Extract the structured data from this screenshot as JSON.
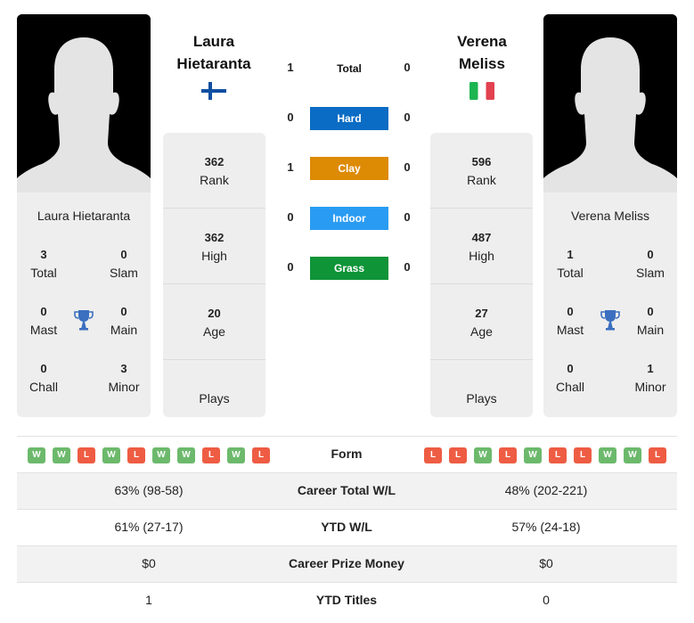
{
  "player_left": {
    "name_line1": "Laura",
    "name_line2": "Hietaranta",
    "full_name": "Laura Hietaranta",
    "flag_icon": "finland-flag-icon",
    "photo_icon": "player-silhouette-icon",
    "titles": {
      "total": {
        "value": "3",
        "label": "Total"
      },
      "slam": {
        "value": "0",
        "label": "Slam"
      },
      "mast": {
        "value": "0",
        "label": "Mast"
      },
      "main": {
        "value": "0",
        "label": "Main"
      },
      "chall": {
        "value": "0",
        "label": "Chall"
      },
      "minor": {
        "value": "3",
        "label": "Minor"
      }
    },
    "stats": {
      "rank": {
        "value": "362",
        "label": "Rank"
      },
      "high": {
        "value": "362",
        "label": "High"
      },
      "age": {
        "value": "20",
        "label": "Age"
      },
      "plays": {
        "value": "",
        "label": "Plays"
      }
    },
    "form": [
      "W",
      "W",
      "L",
      "W",
      "L",
      "W",
      "W",
      "L",
      "W",
      "L"
    ]
  },
  "player_right": {
    "name_line1": "Verena",
    "name_line2": "Meliss",
    "full_name": "Verena Meliss",
    "flag_icon": "italy-flag-icon",
    "photo_icon": "player-silhouette-icon",
    "titles": {
      "total": {
        "value": "1",
        "label": "Total"
      },
      "slam": {
        "value": "0",
        "label": "Slam"
      },
      "mast": {
        "value": "0",
        "label": "Mast"
      },
      "main": {
        "value": "0",
        "label": "Main"
      },
      "chall": {
        "value": "0",
        "label": "Chall"
      },
      "minor": {
        "value": "1",
        "label": "Minor"
      }
    },
    "stats": {
      "rank": {
        "value": "596",
        "label": "Rank"
      },
      "high": {
        "value": "487",
        "label": "High"
      },
      "age": {
        "value": "27",
        "label": "Age"
      },
      "plays": {
        "value": "",
        "label": "Plays"
      }
    },
    "form": [
      "L",
      "L",
      "W",
      "L",
      "W",
      "L",
      "L",
      "W",
      "W",
      "L"
    ]
  },
  "head_to_head": [
    {
      "label": "Total",
      "left": "1",
      "right": "0",
      "color": ""
    },
    {
      "label": "Hard",
      "left": "0",
      "right": "0",
      "color": "#0a6cc4"
    },
    {
      "label": "Clay",
      "left": "1",
      "right": "0",
      "color": "#dd8a05"
    },
    {
      "label": "Indoor",
      "left": "0",
      "right": "0",
      "color": "#2a9bf2"
    },
    {
      "label": "Grass",
      "left": "0",
      "right": "0",
      "color": "#0f9438"
    }
  ],
  "form_label": "Form",
  "comparison": [
    {
      "label": "Career Total W/L",
      "left": "63% (98-58)",
      "right": "48% (202-221)"
    },
    {
      "label": "YTD W/L",
      "left": "61% (27-17)",
      "right": "57% (24-18)"
    },
    {
      "label": "Career Prize Money",
      "left": "$0",
      "right": "$0"
    },
    {
      "label": "YTD Titles",
      "left": "1",
      "right": "0"
    }
  ],
  "colors": {
    "win": "#6cb96c",
    "loss": "#ee5c43",
    "card_bg": "#eeeeee",
    "trophy": "#3b6fbf"
  }
}
